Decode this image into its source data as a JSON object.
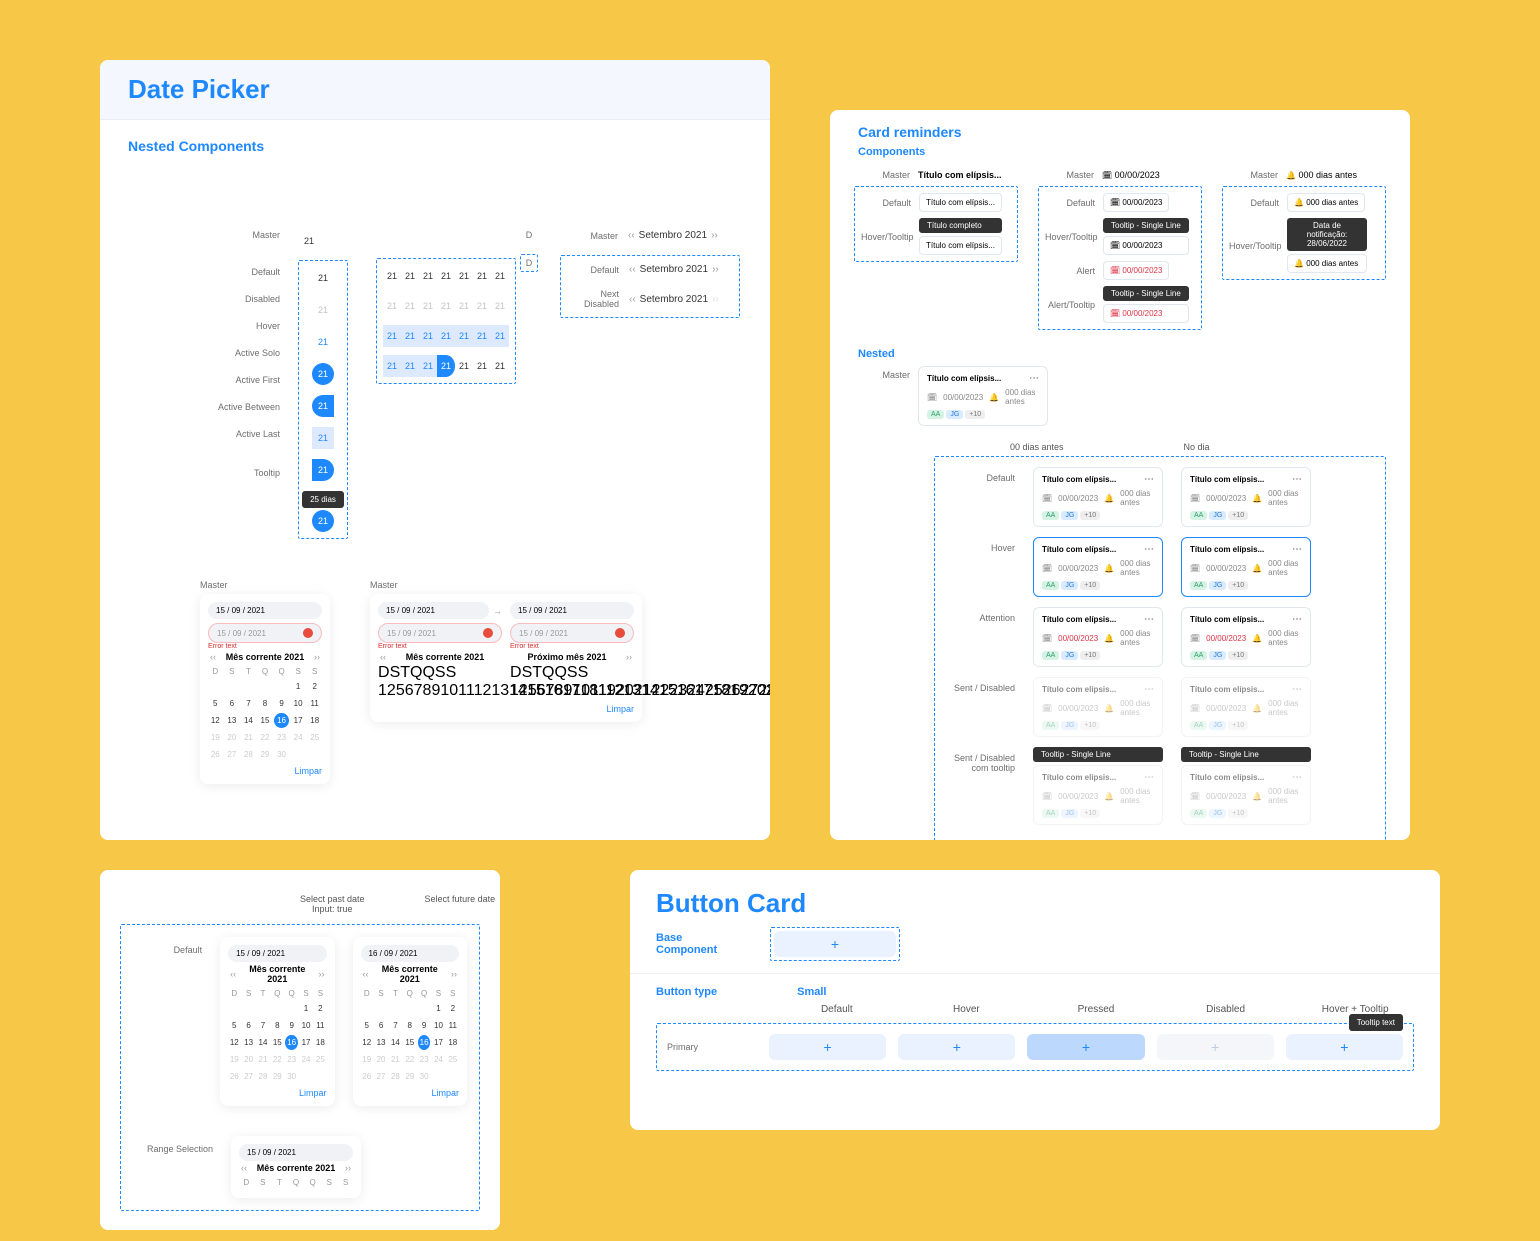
{
  "datepicker": {
    "title": "Date Picker",
    "nested_label": "Nested Components",
    "states": {
      "master": "Master",
      "default": "Default",
      "disabled": "Disabled",
      "hover": "Hover",
      "active_solo": "Active Solo",
      "active_first": "Active First",
      "active_between": "Active Between",
      "active_last": "Active Last",
      "tooltip": "Tooltip"
    },
    "day_value": "21",
    "d_label": "D",
    "tooltip_text": "25 dias",
    "month_nav": {
      "master": "Master",
      "default": "Default",
      "next_disabled": "Next Disabled",
      "month": "Setembro 2021"
    },
    "week_days": [
      "21",
      "21",
      "21",
      "21",
      "21",
      "21",
      "21"
    ],
    "grid_labels": {
      "master": "Master"
    },
    "cal": {
      "master": "Master",
      "input1": "15 / 09 / 2021",
      "input_err": "15 / 09 / 2021",
      "error": "Error text",
      "month_current": "Mês corrente 2021",
      "month_next": "Próximo mês 2021",
      "wd": [
        "D",
        "S",
        "T",
        "Q",
        "Q",
        "S",
        "S"
      ],
      "clear": "Limpar"
    },
    "variants": {
      "past": "Select past date",
      "input_true": "Input: true",
      "future": "Select future date",
      "default": "Default",
      "range": "Range Selection",
      "input_past": "15 / 09 / 2021",
      "input_future": "16 / 09 / 2021"
    }
  },
  "reminders": {
    "title": "Card reminders",
    "components": "Components",
    "nested": "Nested",
    "labels": {
      "master": "Master",
      "default": "Default",
      "hover_tooltip": "Hover/Tooltip",
      "alert": "Alert",
      "alert_tooltip": "Alert/Tooltip",
      "hover": "Hover",
      "attention": "Attention",
      "sent_disabled": "Sent / Disabled",
      "sent_disabled_tt": "Sent / Disabled com tooltip"
    },
    "title_elips": "Título com elípsis...",
    "title_full": "Título completo",
    "date": "00/00/2023",
    "days_before": "000 dias antes",
    "tooltip_sl": "Tooltip - Single Line",
    "tooltip_date": "Data de notificação: 28/06/2022",
    "chips": {
      "a": "AA",
      "b": "JG",
      "plus": "+10"
    },
    "cols": {
      "before": "00 dias antes",
      "on_day": "No dia"
    }
  },
  "buttoncard": {
    "title": "Button Card",
    "base": "Base Component",
    "button_type": "Button type",
    "small": "Small",
    "primary": "Primary",
    "states": {
      "default": "Default",
      "hover": "Hover",
      "pressed": "Pressed",
      "disabled": "Disabled",
      "hover_tt": "Hover + Tooltip"
    },
    "tooltip": "Tooltip text"
  }
}
